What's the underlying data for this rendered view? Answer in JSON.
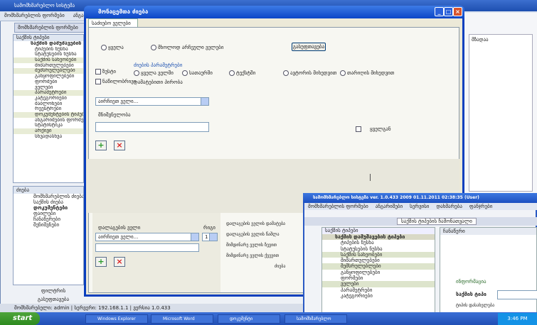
{
  "background_app": {
    "title": "სამომხმარებლო სისტემა",
    "menu": [
      "მომხმარებლის ფორმები",
      "ანგარიშები",
      "სერვისი",
      "დახმარება"
    ],
    "tab": "მომხმარებლის ფორმები",
    "sidebar_header": "საქმის ტიპები",
    "sidebar_items": [
      {
        "label": "საქმის დამუშავების ტიპები",
        "style": "bold"
      },
      {
        "label": "ტიპების ნუსხა",
        "style": ""
      },
      {
        "label": "სტატუსების ნუსხა",
        "style": ""
      },
      {
        "label": "საქმის სახეობები",
        "style": "hl"
      },
      {
        "label": "მიმართულებები",
        "style": ""
      },
      {
        "label": "შემსრულებლები",
        "style": "hl"
      },
      {
        "label": "განყოფილებები",
        "style": ""
      },
      {
        "label": "ფორმები",
        "style": ""
      },
      {
        "label": "ველები",
        "style": ""
      },
      {
        "label": "პარამეტრები",
        "style": "hl"
      },
      {
        "label": "კატეგორიები",
        "style": ""
      },
      {
        "label": "შაბლონები",
        "style": ""
      },
      {
        "label": "რეესტრები",
        "style": ""
      },
      {
        "label": "დოკუმენტების ტიპები",
        "style": "hl"
      },
      {
        "label": "ანგარიშების ფორმები",
        "style": ""
      },
      {
        "label": "სტატისტიკა",
        "style": ""
      },
      {
        "label": "არქივი",
        "style": "hl"
      },
      {
        "label": "სხვადასხვა",
        "style": ""
      }
    ],
    "sidebar2_header": "ძიება",
    "sidebar2_items": [
      {
        "label": "მომხმარებლის ძიება",
        "style": ""
      },
      {
        "label": "საქმის ძიება",
        "style": ""
      },
      {
        "label": "დოკუმენტები",
        "style": "bold"
      },
      {
        "label": "ფაილები",
        "style": ""
      },
      {
        "label": "ჩანაწერები",
        "style": ""
      },
      {
        "label": "შენიშვნები",
        "style": ""
      }
    ],
    "bottom_label": "ფილტრის გასუფთავება",
    "statusbar": "მომხმარებელი: admin | სერვერი: 192.168.1.1 | ვერსია 1.0.433",
    "right_panel_text": "მზადაა"
  },
  "dialog": {
    "title": "მონაცემთა ძიება",
    "tab": "საძიებო ველები",
    "radio_all": "ყველა",
    "radio_selected": "მხოლოდ არჩეული ველები",
    "button_clear": "გასუფთავება",
    "cb_exact": "ზუსტი",
    "cb_partial": "ნაწილობრივი",
    "group_label": "ძიების პარამეტრები",
    "options": [
      "ყველა ველში",
      "სათაურში",
      "ტექსტში",
      "ავტორის მიხედვით",
      "თარიღის მიხედვით"
    ],
    "sub_label": "დამატებითი პირობა",
    "field_select": "აირჩიეთ ველი...",
    "value_label": "მნიშვნელობა",
    "checkbox_right": "ყველგან",
    "lower_select": "აირჩიეთ ველი...",
    "lower_field_label": "დალაგების ველი",
    "order_label": "რიგი",
    "order_value": "1",
    "side_texts": [
      "დალაგების ველის დამატება",
      "დალაგების ველის წაშლა",
      "მიმდინარე ველის ზევით",
      "მიმდინარე ველის ქვევით",
      "ძიება"
    ]
  },
  "inner_window": {
    "title": "სამომხმარებლო სისტემა ver. 1.0.433 2009 01.11.2011 02:38:35 (User)",
    "menu": [
      "მომხმარებლის ფორმები",
      "ანგარიშები",
      "სერვისი",
      "დახმარება",
      "ფანჯრები"
    ],
    "tab": "საქმის ტიპების ჩამონათვალი",
    "sidebar_header": "საქმის ტიპები",
    "items": [
      {
        "label": "საქმის დამუშავების ტიპები",
        "style": "bold"
      },
      {
        "label": "ტიპების ნუსხა",
        "style": ""
      },
      {
        "label": "სტატუსების ნუსხა",
        "style": ""
      },
      {
        "label": "საქმის სახეობები",
        "style": "hl"
      },
      {
        "label": "მიმართულებები",
        "style": ""
      },
      {
        "label": "შემსრულებლები",
        "style": "hl"
      },
      {
        "label": "განყოფილებები",
        "style": ""
      },
      {
        "label": "ფორმები",
        "style": ""
      },
      {
        "label": "ველები",
        "style": "hl"
      },
      {
        "label": "პარამეტრები",
        "style": ""
      },
      {
        "label": "კატეგორიები",
        "style": ""
      }
    ],
    "main_header": "ჩანაწერი",
    "main_label": "ინფორმაცია",
    "bold_label": "საქმის ტიპი",
    "small_label": "ტიპის დასახელება"
  },
  "taskbar": {
    "start": "start",
    "tasks": [
      "Windows Explorer",
      "Microsoft Word",
      "დოკუმენტი",
      "სამომხმარებლო"
    ],
    "clock": "3:46 PM"
  },
  "colors": {
    "titlebar": "#0b45c7",
    "dialog_bg": "#ece9d8",
    "taskbar": "#245edb",
    "start": "#2d8a1f"
  }
}
